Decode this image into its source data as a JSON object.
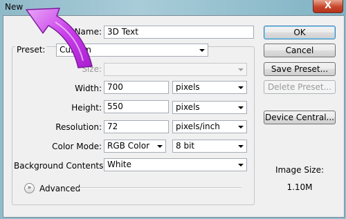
{
  "window": {
    "title": "New",
    "close_label": "X"
  },
  "form": {
    "name_label": "Name:",
    "name_value": "3D Text",
    "preset_label": "Preset:",
    "preset_value": "Custom",
    "size_label": "Size:",
    "size_value": "",
    "width_label": "Width:",
    "width_value": "700",
    "width_unit": "pixels",
    "height_label": "Height:",
    "height_value": "550",
    "height_unit": "pixels",
    "resolution_label": "Resolution:",
    "resolution_value": "72",
    "resolution_unit": "pixels/inch",
    "color_mode_label": "Color Mode:",
    "color_mode_value": "RGB Color",
    "bit_depth_value": "8 bit",
    "background_label": "Background Contents:",
    "background_value": "White",
    "advanced_label": "Advanced"
  },
  "buttons": {
    "ok": "OK",
    "cancel": "Cancel",
    "save_preset": "Save Preset...",
    "delete_preset": "Delete Preset...",
    "device_central": "Device Central..."
  },
  "info": {
    "image_size_label": "Image Size:",
    "image_size_value": "1.10M"
  },
  "icons": {
    "advanced_toggle": "double-chevron-down-icon",
    "annotation": "curved-arrow-icon"
  },
  "colors": {
    "annotation_arrow": "#cc33ee",
    "default_button_border": "#3c7fb1"
  }
}
